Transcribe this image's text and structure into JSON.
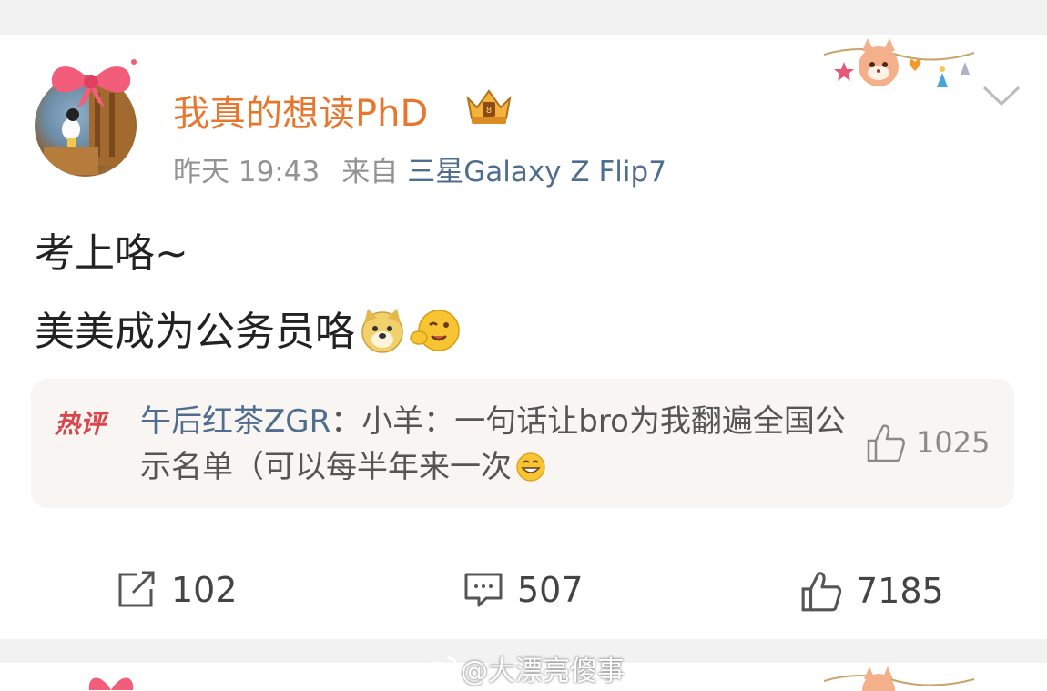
{
  "post": {
    "username": "我真的想读PhD",
    "time": "昨天 19:43",
    "from_label": "来自",
    "device": "三星Galaxy Z Flip7",
    "line1": "考上咯~",
    "line2": "美美成为公务员咯"
  },
  "hot_comment": {
    "badge": "热评",
    "author": "午后红茶ZGR",
    "separator": "：",
    "text": "小羊：一句话让bro为我翻遍全国公示名单（可以每半年来一次",
    "likes": "1025"
  },
  "actions": {
    "reposts": "102",
    "comments": "507",
    "likes": "7185"
  },
  "watermark": "@大漂亮傻事",
  "colors": {
    "username": "#e8762d",
    "link": "#4f6d8f",
    "meta": "#939393",
    "hot_badge": "#d9474c"
  }
}
